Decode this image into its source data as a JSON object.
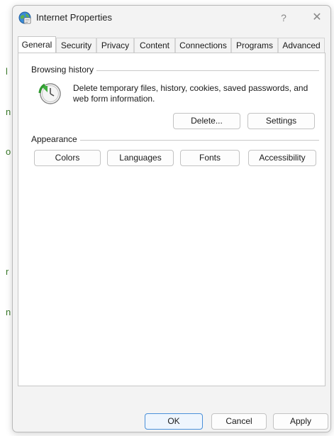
{
  "window": {
    "title": "Internet Properties",
    "help_glyph": "?",
    "close_glyph": "✕"
  },
  "tabs": [
    {
      "label": "General",
      "active": true
    },
    {
      "label": "Security"
    },
    {
      "label": "Privacy"
    },
    {
      "label": "Content"
    },
    {
      "label": "Connections"
    },
    {
      "label": "Programs"
    },
    {
      "label": "Advanced"
    }
  ],
  "browsing_history": {
    "label": "Browsing history",
    "description": "Delete temporary files, history, cookies, saved passwords, and web form information.",
    "delete_label": "Delete...",
    "settings_label": "Settings"
  },
  "appearance": {
    "label": "Appearance",
    "colors_label": "Colors",
    "languages_label": "Languages",
    "fonts_label": "Fonts",
    "accessibility_label": "Accessibility"
  },
  "footer": {
    "ok_label": "OK",
    "cancel_label": "Cancel",
    "apply_label": "Apply"
  },
  "background": {
    "letters": [
      "l",
      "n",
      "o",
      "r",
      "n"
    ]
  },
  "colors": {
    "dialog_bg": "#f3f3f3",
    "panel_bg": "#ffffff",
    "primary_border": "#4a90d9",
    "bg_accent": "#3a7a2a"
  }
}
